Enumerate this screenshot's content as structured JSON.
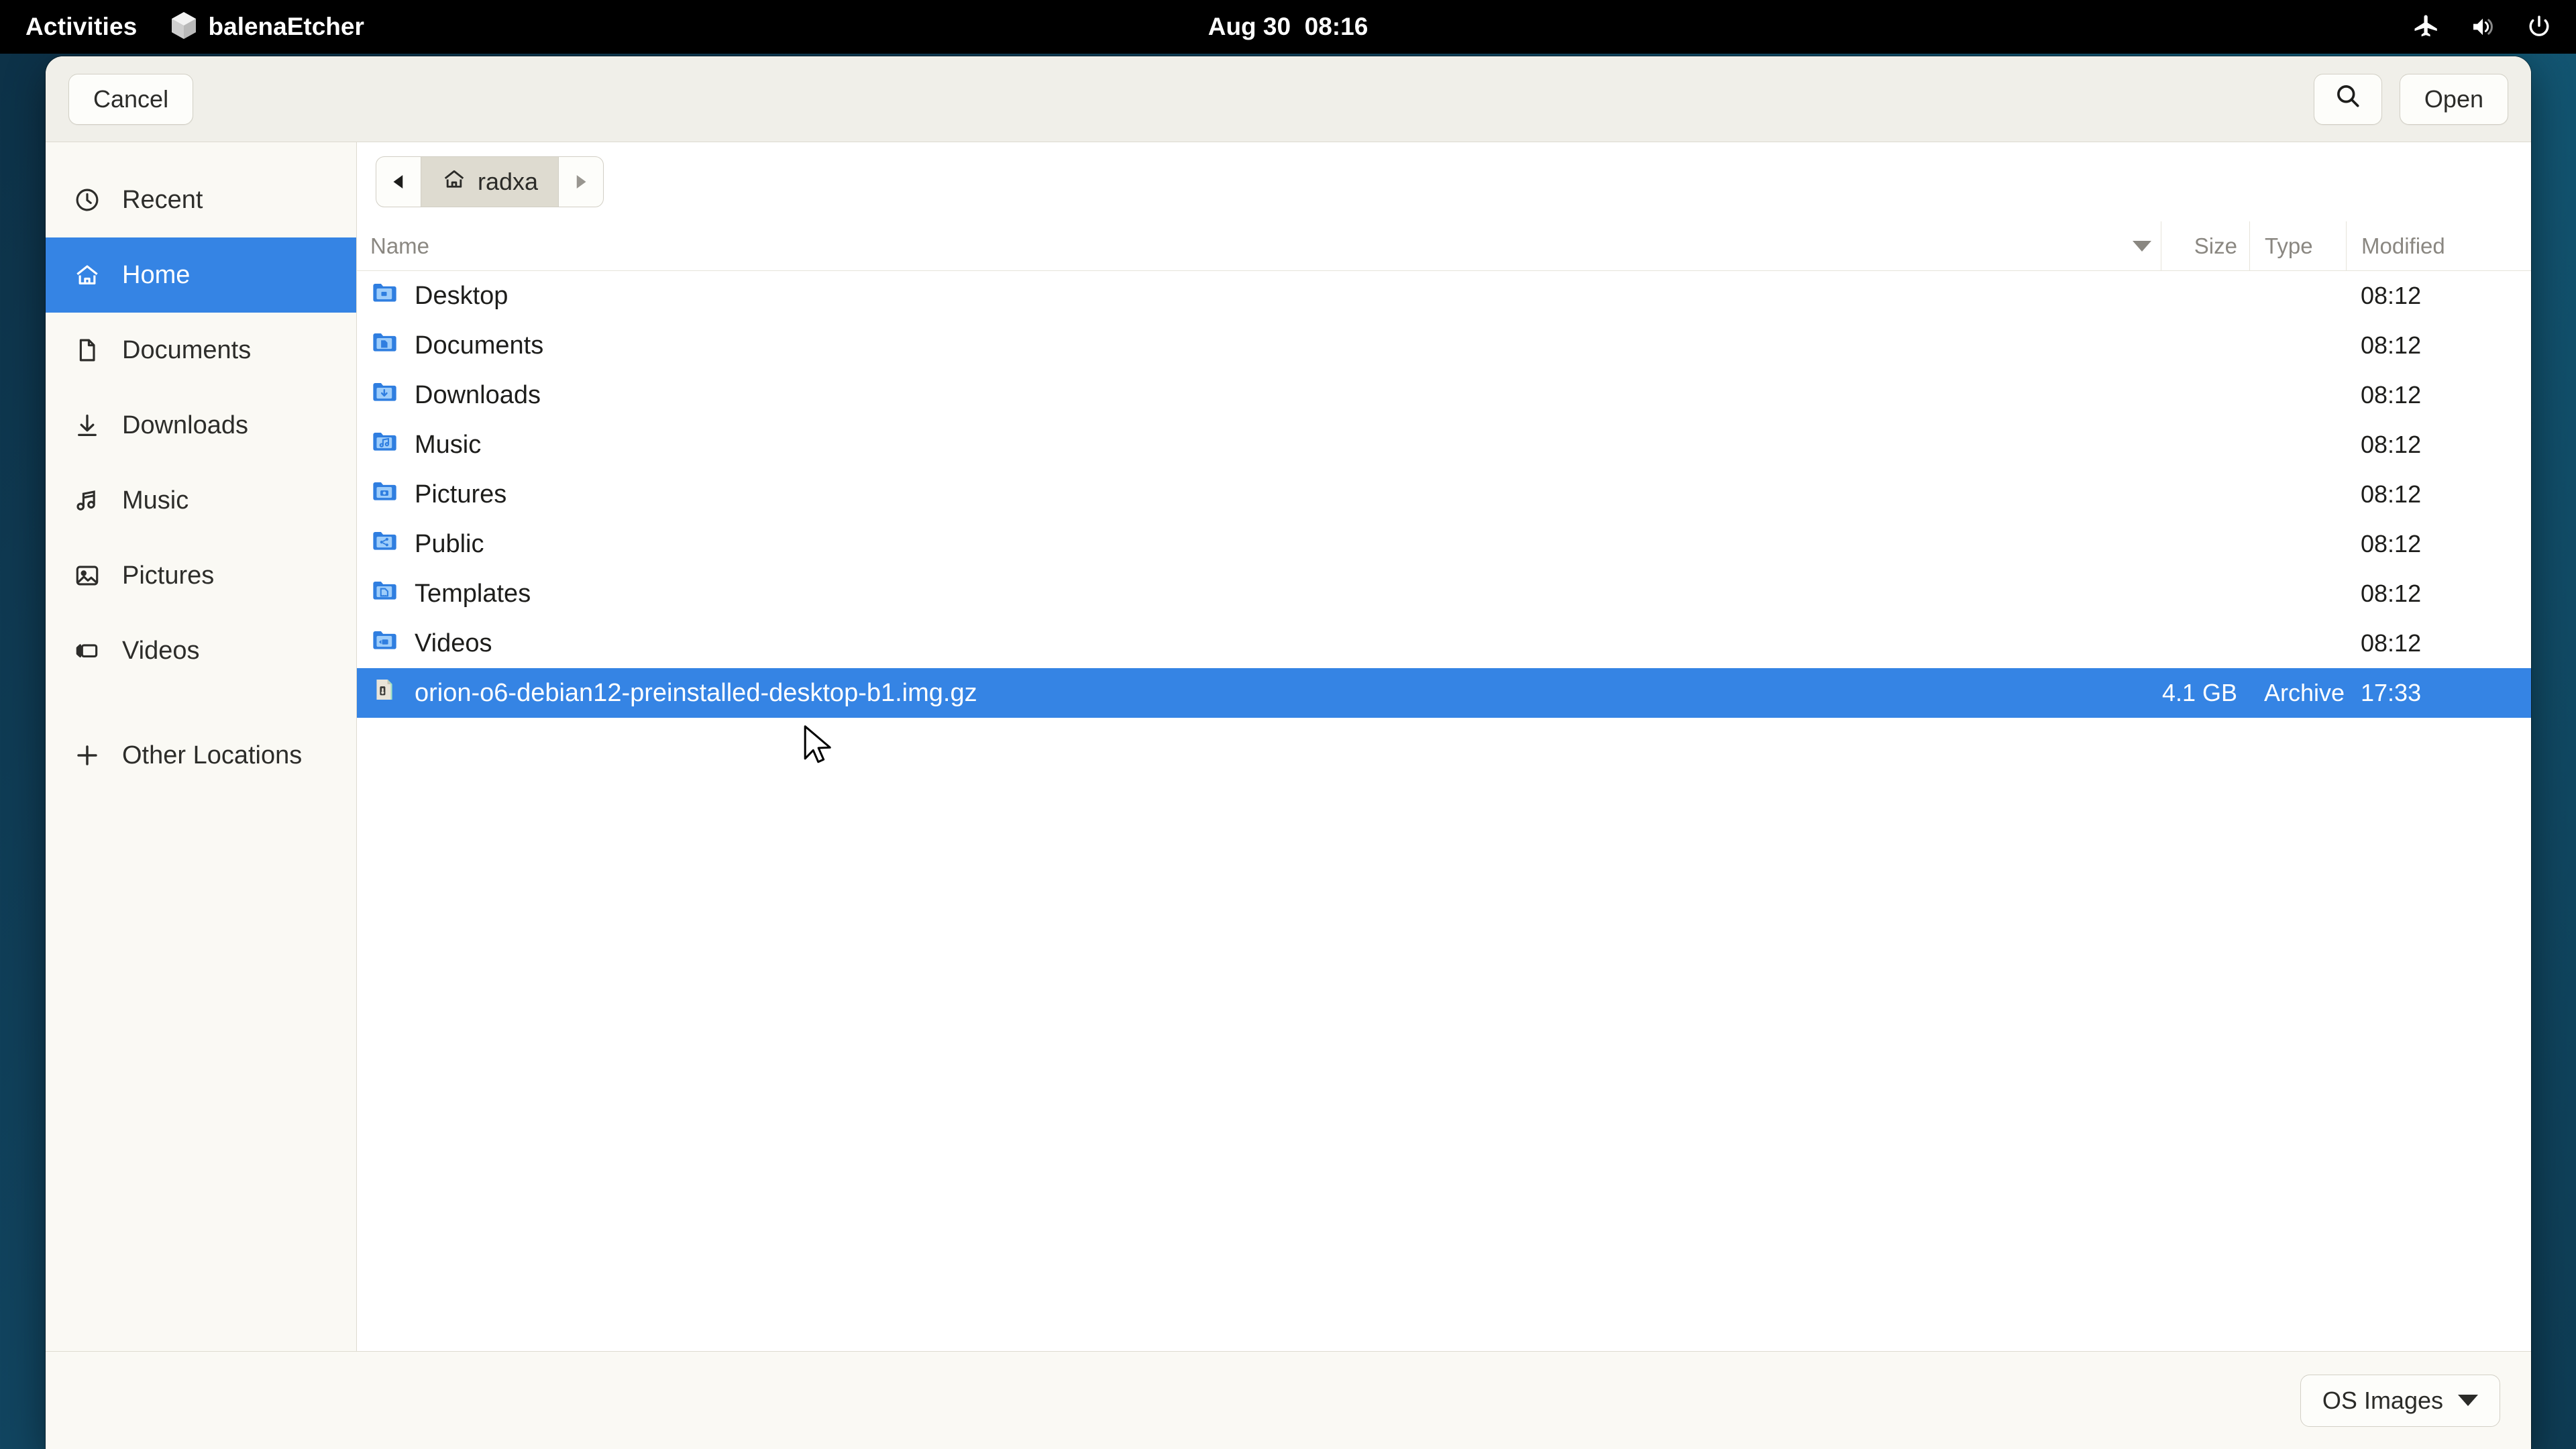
{
  "topbar": {
    "activities": "Activities",
    "app_name": "balenaEtcher",
    "clock": "Aug 30  08:16",
    "icons": [
      "airplane-mode-icon",
      "volume-icon",
      "power-icon"
    ]
  },
  "dialog": {
    "header": {
      "cancel_label": "Cancel",
      "open_label": "Open",
      "search_icon": "search-icon"
    },
    "pathbar": {
      "back_icon": "triangle-left-icon",
      "forward_icon": "triangle-right-icon",
      "crumb_label": "radxa",
      "crumb_icon": "home-icon"
    },
    "columns": {
      "name": "Name",
      "size": "Size",
      "type": "Type",
      "modified": "Modified",
      "sort_direction": "descending"
    },
    "filter": {
      "label": "OS Images",
      "caret_icon": "chevron-down-icon"
    }
  },
  "sidebar": {
    "items": [
      {
        "label": "Recent",
        "icon": "clock-icon",
        "selected": false
      },
      {
        "label": "Home",
        "icon": "home-icon",
        "selected": true
      },
      {
        "label": "Documents",
        "icon": "document-icon",
        "selected": false
      },
      {
        "label": "Downloads",
        "icon": "download-icon",
        "selected": false
      },
      {
        "label": "Music",
        "icon": "music-note-icon",
        "selected": false
      },
      {
        "label": "Pictures",
        "icon": "image-icon",
        "selected": false
      },
      {
        "label": "Videos",
        "icon": "video-icon",
        "selected": false
      },
      {
        "label": "Other Locations",
        "icon": "plus-icon",
        "selected": false
      }
    ]
  },
  "files": {
    "rows": [
      {
        "name": "Desktop",
        "size": "",
        "type": "",
        "modified": "08:12",
        "icon": "folder-desktop-icon",
        "selected": false
      },
      {
        "name": "Documents",
        "size": "",
        "type": "",
        "modified": "08:12",
        "icon": "folder-documents-icon",
        "selected": false
      },
      {
        "name": "Downloads",
        "size": "",
        "type": "",
        "modified": "08:12",
        "icon": "folder-downloads-icon",
        "selected": false
      },
      {
        "name": "Music",
        "size": "",
        "type": "",
        "modified": "08:12",
        "icon": "folder-music-icon",
        "selected": false
      },
      {
        "name": "Pictures",
        "size": "",
        "type": "",
        "modified": "08:12",
        "icon": "folder-pictures-icon",
        "selected": false
      },
      {
        "name": "Public",
        "size": "",
        "type": "",
        "modified": "08:12",
        "icon": "folder-public-icon",
        "selected": false
      },
      {
        "name": "Templates",
        "size": "",
        "type": "",
        "modified": "08:12",
        "icon": "folder-templates-icon",
        "selected": false
      },
      {
        "name": "Videos",
        "size": "",
        "type": "",
        "modified": "08:12",
        "icon": "folder-videos-icon",
        "selected": false
      },
      {
        "name": "orion-o6-debian12-preinstalled-desktop-b1.img.gz",
        "size": "4.1 GB",
        "type": "Archive",
        "modified": "17:33",
        "icon": "archive-file-icon",
        "selected": true
      }
    ]
  },
  "colors": {
    "accent": "#3584e4",
    "topbar_bg": "#000000",
    "desktop_bg": "#11445f",
    "sidebar_bg": "#faf9f4",
    "header_bg": "#f0efe9"
  }
}
